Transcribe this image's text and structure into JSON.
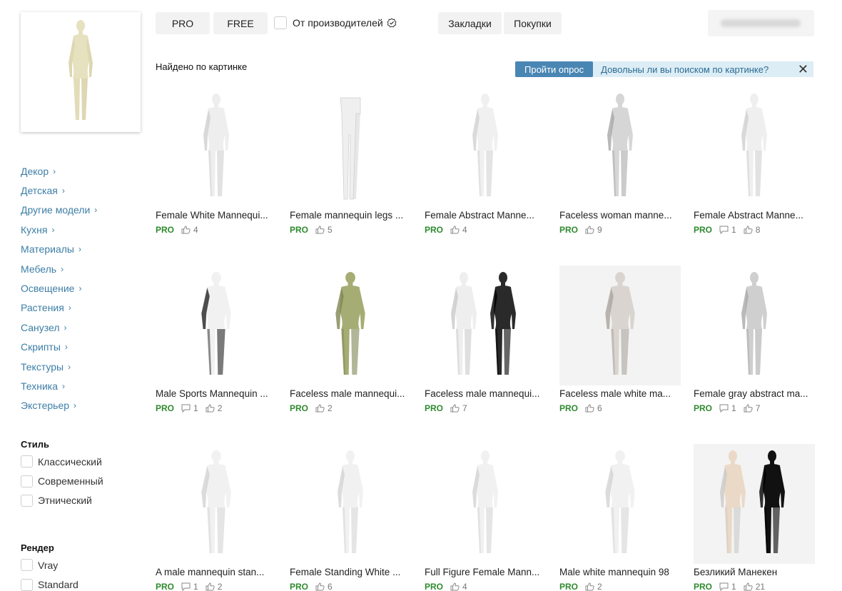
{
  "top": {
    "pro_label": "PRO",
    "free_label": "FREE",
    "manufacturers_label": "От производителей",
    "bookmarks_label": "Закладки",
    "purchases_label": "Покупки"
  },
  "results": {
    "heading": "Найдено по картинке"
  },
  "survey": {
    "button_label": "Пройти опрос",
    "question": "Довольны ли вы поиском по картинке?"
  },
  "categories": [
    "Декор",
    "Детская",
    "Другие модели",
    "Кухня",
    "Материалы",
    "Мебель",
    "Освещение",
    "Растения",
    "Санузел",
    "Скрипты",
    "Текстуры",
    "Техника",
    "Экстерьер"
  ],
  "style_filter": {
    "title": "Стиль",
    "options": [
      "Классический",
      "Современный",
      "Этнический"
    ]
  },
  "render_filter": {
    "title": "Рендер",
    "options": [
      "Vray",
      "Standard"
    ]
  },
  "models": [
    {
      "title": "Female White Mannequi...",
      "badge": "PRO",
      "comments": "",
      "likes": "4",
      "figure": "female",
      "color": "#eeeeee",
      "shade": "#cfcfcf",
      "bg": false
    },
    {
      "title": "Female mannequin legs ...",
      "badge": "PRO",
      "comments": "",
      "likes": "5",
      "figure": "legs",
      "color": "#efefef",
      "shade": "#d0d0d0",
      "bg": false
    },
    {
      "title": "Female Abstract Manne...",
      "badge": "PRO",
      "comments": "",
      "likes": "4",
      "figure": "female",
      "color": "#f0f0f0",
      "shade": "#d2d2d2",
      "bg": false
    },
    {
      "title": "Faceless woman manne...",
      "badge": "PRO",
      "comments": "",
      "likes": "9",
      "figure": "female",
      "color": "#d6d6d6",
      "shade": "#a8a8a8",
      "bg": false
    },
    {
      "title": "Female Abstract Manne...",
      "badge": "PRO",
      "comments": "1",
      "likes": "8",
      "figure": "female",
      "color": "#efefef",
      "shade": "#cfcfcf",
      "bg": false
    },
    {
      "title": "Male Sports Mannequin ...",
      "badge": "PRO",
      "comments": "1",
      "likes": "2",
      "figure": "male",
      "color": "#f1f1f1",
      "shade": "#222222",
      "bg": false
    },
    {
      "title": "Faceless male mannequi...",
      "badge": "PRO",
      "comments": "",
      "likes": "2",
      "figure": "male",
      "color": "#a6ad74",
      "shade": "#7f8654",
      "bg": false
    },
    {
      "title": "Faceless male mannequi...",
      "badge": "PRO",
      "comments": "",
      "likes": "7",
      "figure": "pair",
      "color": "#eeeeee",
      "shade": "#2a2a2a",
      "bg": false
    },
    {
      "title": "Faceless male white ma...",
      "badge": "PRO",
      "comments": "",
      "likes": "6",
      "figure": "male",
      "color": "#d9d4cf",
      "shade": "#aaa39c",
      "bg": true
    },
    {
      "title": "Female gray abstract ma...",
      "badge": "PRO",
      "comments": "1",
      "likes": "7",
      "figure": "female",
      "color": "#cfcfcf",
      "shade": "#a9a9a9",
      "bg": false
    },
    {
      "title": "A male mannequin stan...",
      "badge": "PRO",
      "comments": "1",
      "likes": "2",
      "figure": "male",
      "color": "#f1f1f1",
      "shade": "#d3d3d3",
      "bg": false
    },
    {
      "title": "Female Standing White ...",
      "badge": "PRO",
      "comments": "",
      "likes": "6",
      "figure": "female",
      "color": "#f1f1f1",
      "shade": "#d3d3d3",
      "bg": false
    },
    {
      "title": "Full Figure Female Mann...",
      "badge": "PRO",
      "comments": "",
      "likes": "4",
      "figure": "female",
      "color": "#f1f1f1",
      "shade": "#d3d3d3",
      "bg": false
    },
    {
      "title": "Male white mannequin 98",
      "badge": "PRO",
      "comments": "",
      "likes": "2",
      "figure": "male",
      "color": "#f1f1f1",
      "shade": "#d3d3d3",
      "bg": false
    },
    {
      "title": "Безликий Манекен",
      "badge": "PRO",
      "comments": "1",
      "likes": "21",
      "figure": "pair",
      "color": "#ead9c6",
      "shade": "#111111",
      "bg": true
    }
  ],
  "colors": {
    "link": "#3d7ea6",
    "pro": "#2e8a2e",
    "survey_button": "#4a86b3",
    "survey_bg": "#dcedf5"
  }
}
